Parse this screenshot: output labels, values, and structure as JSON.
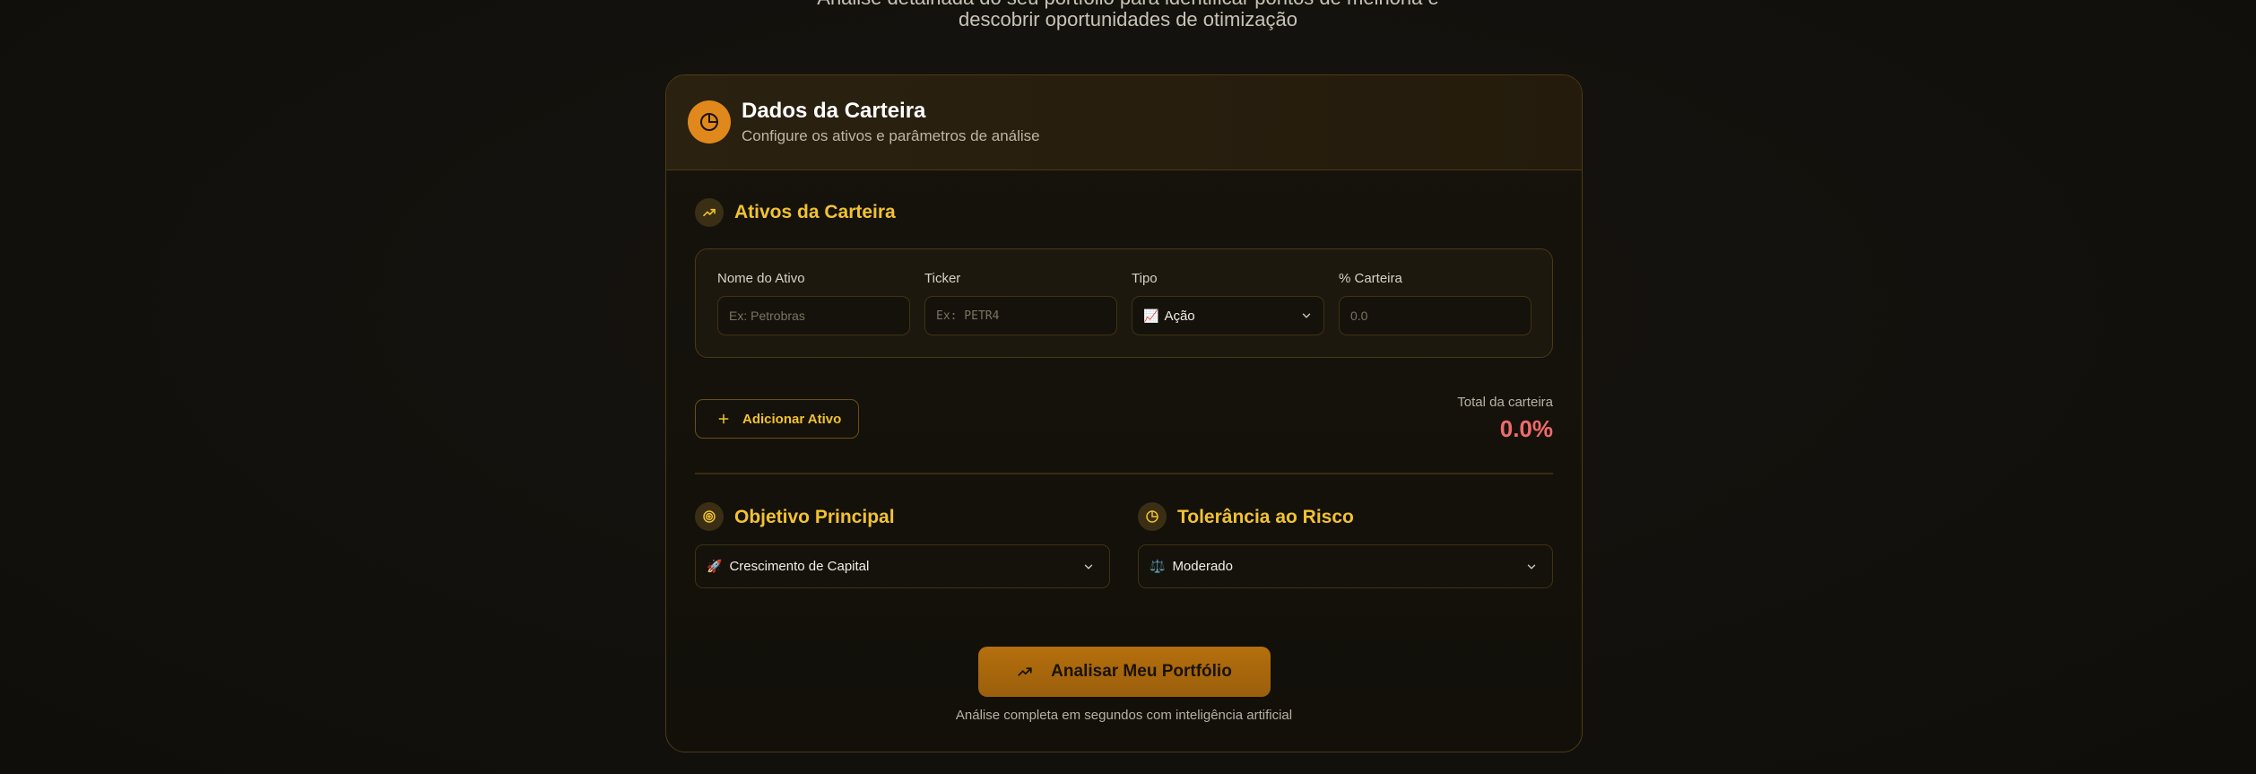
{
  "intro": {
    "line1": "Análise detalhada do seu portfólio para identificar pontos de melhoria e",
    "line2": "descobrir oportunidades de otimização"
  },
  "card": {
    "title": "Dados da Carteira",
    "subtitle": "Configure os ativos e parâmetros de análise",
    "header_icon": "pie-chart-icon"
  },
  "assets_section": {
    "title": "Ativos da Carteira",
    "icon": "trending-up-icon",
    "fields": {
      "name_label": "Nome do Ativo",
      "name_placeholder": "Ex: Petrobras",
      "ticker_label": "Ticker",
      "ticker_placeholder": "Ex: PETR4",
      "type_label": "Tipo",
      "type_value": "Ação",
      "type_emoji": "📈",
      "percent_label": "% Carteira",
      "percent_placeholder": "0.0"
    },
    "add_button": "Adicionar Ativo",
    "total_label": "Total da carteira",
    "total_value": "0.0%"
  },
  "objective": {
    "title": "Objetivo Principal",
    "icon": "target-icon",
    "emoji": "🚀",
    "value": "Crescimento de Capital"
  },
  "risk": {
    "title": "Tolerância ao Risco",
    "icon": "gauge-icon",
    "emoji": "⚖️",
    "value": "Moderado"
  },
  "analyze_button": "Analisar Meu Portfólio",
  "footnote": "Análise completa em segundos com inteligência artificial",
  "colors": {
    "accent": "#f1c232",
    "orange": "#e0881c",
    "button": "#a8660d",
    "negative": "#f06a6a"
  }
}
